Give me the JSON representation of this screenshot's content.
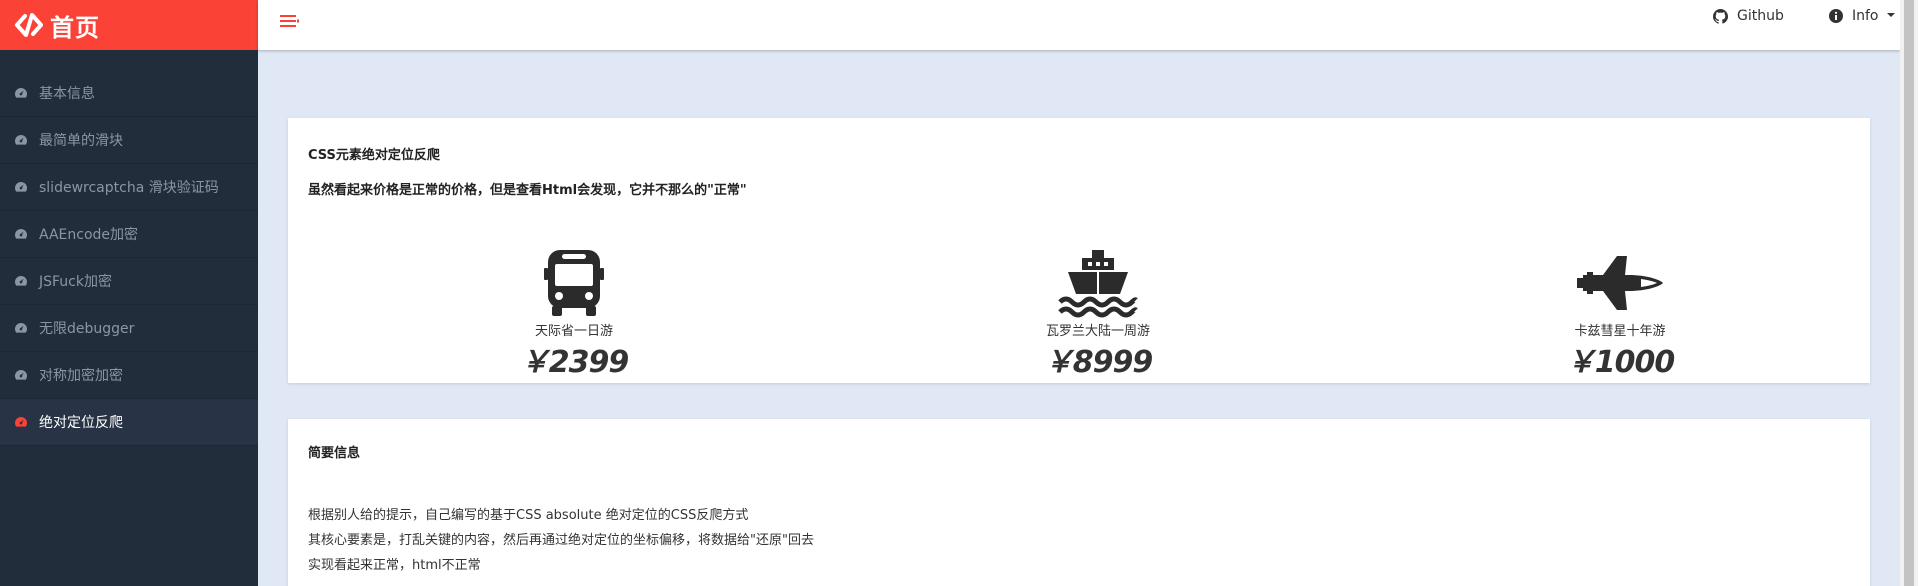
{
  "brand": {
    "title": "首页"
  },
  "menu": [
    {
      "label": "基本信息",
      "active": false
    },
    {
      "label": "最简单的滑块",
      "active": false
    },
    {
      "label": "slidewrcaptcha 滑块验证码",
      "active": false
    },
    {
      "label": "AAEncode加密",
      "active": false
    },
    {
      "label": "JSFuck加密",
      "active": false
    },
    {
      "label": "无限debugger",
      "active": false
    },
    {
      "label": "对称加密加密",
      "active": false
    },
    {
      "label": "绝对定位反爬",
      "active": true
    }
  ],
  "header": {
    "github_label": "Github",
    "info_label": "Info"
  },
  "card1": {
    "title": "CSS元素绝对定位反爬",
    "subtitle": "虽然看起来价格是正常的价格，但是查看Html会发现，它并不那么的\"正常\"",
    "tours": [
      {
        "icon": "bus-icon",
        "name": "天际省一日游",
        "price": "￥2399"
      },
      {
        "icon": "ship-icon",
        "name": "瓦罗兰大陆一周游",
        "price": "￥8999"
      },
      {
        "icon": "space-shuttle-icon",
        "name": "卡兹彗星十年游",
        "price": "￥1000"
      }
    ]
  },
  "card2": {
    "title": "简要信息",
    "lines": [
      "根据别人给的提示，自己编写的基于CSS absolute 绝对定位的CSS反爬方式",
      "其核心要素是，打乱关键的内容，然后再通过绝对定位的坐标偏移，将数据给\"还原\"回去",
      "实现看起来正常，html不正常"
    ]
  },
  "colors": {
    "brand_red": "#fb4237",
    "sidebar_bg": "#222d3c",
    "page_bg": "#e1e8f5"
  }
}
